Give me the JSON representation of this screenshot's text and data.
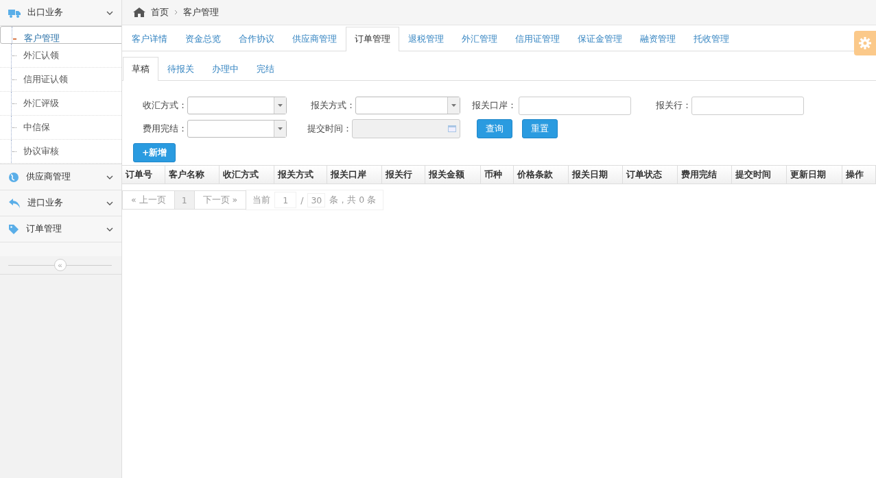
{
  "sidebar": {
    "groups": [
      {
        "label": "出口业务",
        "items": [
          {
            "label": "客户管理",
            "selected": true
          },
          {
            "label": "外汇认领",
            "selected": false
          },
          {
            "label": "信用证认领",
            "selected": false
          },
          {
            "label": "外汇评级",
            "selected": false
          },
          {
            "label": "中信保",
            "selected": false
          },
          {
            "label": "协议审核",
            "selected": false
          }
        ]
      },
      {
        "label": "供应商管理"
      },
      {
        "label": "进口业务"
      },
      {
        "label": "订单管理"
      }
    ],
    "collapse": "«"
  },
  "breadcrumb": [
    "首页",
    "客户管理"
  ],
  "tabs": [
    {
      "label": "客户详情",
      "selected": false
    },
    {
      "label": "资金总览",
      "selected": false
    },
    {
      "label": "合作协议",
      "selected": false
    },
    {
      "label": "供应商管理",
      "selected": false
    },
    {
      "label": "订单管理",
      "selected": true
    },
    {
      "label": "退税管理",
      "selected": false
    },
    {
      "label": "外汇管理",
      "selected": false
    },
    {
      "label": "信用证管理",
      "selected": false
    },
    {
      "label": "保证金管理",
      "selected": false
    },
    {
      "label": "融资管理",
      "selected": false
    },
    {
      "label": "托收管理",
      "selected": false
    }
  ],
  "subtabs": [
    {
      "label": "草稿",
      "selected": true
    },
    {
      "label": "待报关",
      "selected": false
    },
    {
      "label": "办理中",
      "selected": false
    },
    {
      "label": "完结",
      "selected": false
    }
  ],
  "filters": [
    {
      "label": "收汇方式：",
      "kind": "select"
    },
    {
      "label": "报关方式：",
      "kind": "select"
    },
    {
      "label": "报关口岸：",
      "kind": "input"
    },
    {
      "label": "报关行：",
      "kind": "input"
    },
    {
      "label": "费用完结：",
      "kind": "select"
    },
    {
      "label": "提交时间：",
      "kind": "date"
    }
  ],
  "buttons": {
    "query": "查询",
    "reset": "重置",
    "add": "+新增"
  },
  "table": {
    "columns": [
      "订单号",
      "客户名称",
      "收汇方式",
      "报关方式",
      "报关口岸",
      "报关行",
      "报关金额",
      "币种",
      "价格条款",
      "报关日期",
      "订单状态",
      "费用完结",
      "提交时间",
      "更新日期",
      "操作"
    ]
  },
  "pagination": {
    "prev": "« 上一页",
    "page": "1",
    "next": "下一页 »",
    "current_label": "当前",
    "current": "1",
    "slash": "/",
    "total_pages": "30",
    "summary": "条，共 0 条"
  }
}
